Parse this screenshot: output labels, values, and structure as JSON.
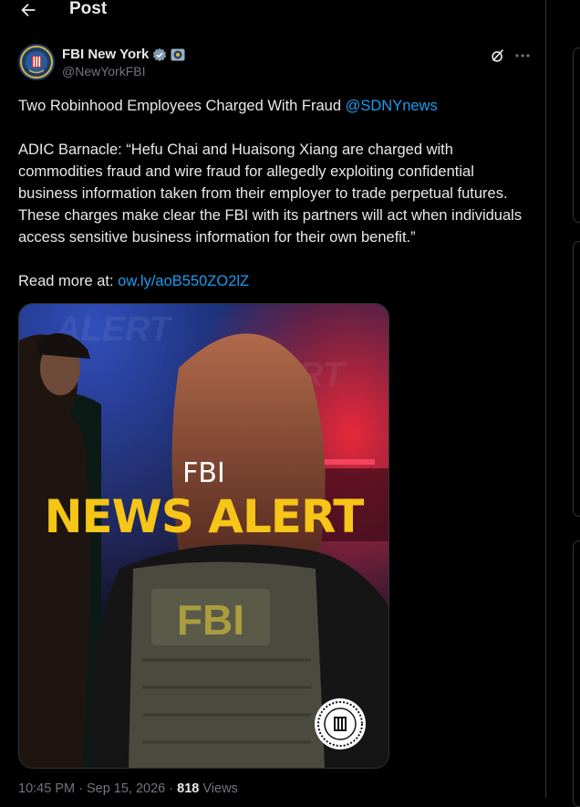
{
  "header": {
    "title": "Post"
  },
  "author": {
    "name": "FBI New York",
    "handle": "@NewYorkFBI"
  },
  "tweet": {
    "headline": "Two Robinhood Employees Charged With Fraud ",
    "mention": "@SDNYnews",
    "quote": "ADIC Barnacle: “Hefu Chai and Huaisong Xiang are charged with commodities fraud and wire fraud for allegedly exploiting confidential business information taken from their employer to trade perpetual futures. These charges make clear the FBI with its partners will act when individuals access sensitive business information for their own benefit.”",
    "read_more_label": "Read more at: ",
    "link": "ow.ly/aoB550ZO2lZ"
  },
  "media": {
    "line1": "FBI",
    "line2": "NEWS ALERT",
    "vest_text": "FBI",
    "bg_text": "ALERT",
    "accent_color": "#f5c518"
  },
  "meta": {
    "time": "10:45 PM",
    "sep": " · ",
    "date": "Sep 15, 2026",
    "views_count": "818",
    "views_label": " Views"
  },
  "icons": [
    "back-arrow-icon",
    "verified-badge-icon",
    "affiliate-badge-icon",
    "grok-icon",
    "more-icon",
    "fbi-seal-icon"
  ]
}
